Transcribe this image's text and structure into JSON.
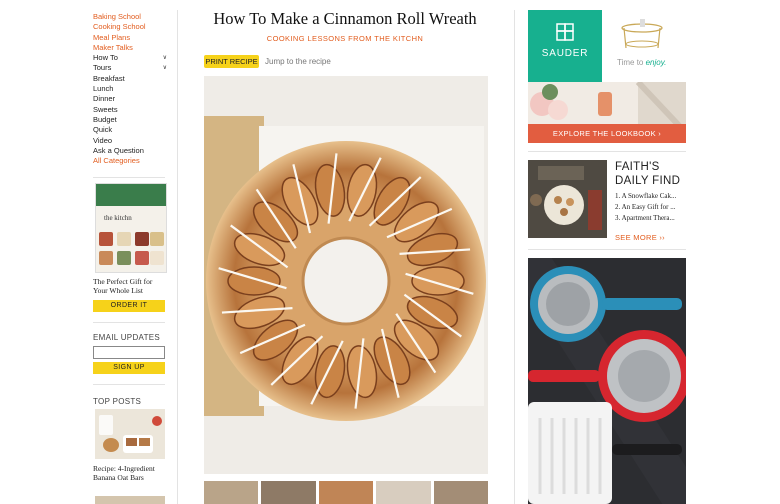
{
  "sidebar": {
    "nav": [
      {
        "label": "Baking School",
        "color": "orange",
        "chevron": false
      },
      {
        "label": "Cooking School",
        "color": "orange",
        "chevron": false
      },
      {
        "label": "Meal Plans",
        "color": "orange",
        "chevron": false
      },
      {
        "label": "Maker Talks",
        "color": "orange",
        "chevron": false
      },
      {
        "label": "How To",
        "color": "dark",
        "chevron": true
      },
      {
        "label": "Tours",
        "color": "dark",
        "chevron": true
      },
      {
        "label": "Breakfast",
        "color": "dark",
        "chevron": false
      },
      {
        "label": "Lunch",
        "color": "dark",
        "chevron": false
      },
      {
        "label": "Dinner",
        "color": "dark",
        "chevron": false
      },
      {
        "label": "Sweets",
        "color": "dark",
        "chevron": false
      },
      {
        "label": "Budget",
        "color": "dark",
        "chevron": false
      },
      {
        "label": "Quick",
        "color": "dark",
        "chevron": false
      },
      {
        "label": "Video",
        "color": "dark",
        "chevron": false
      },
      {
        "label": "Ask a Question",
        "color": "dark",
        "chevron": false
      },
      {
        "label": "All Categories",
        "color": "orange",
        "chevron": false
      }
    ],
    "promo": {
      "book_title": "the kitchn",
      "caption_line1": "The Perfect Gift for",
      "caption_line2": "Your Whole List",
      "button": "ORDER IT"
    },
    "email": {
      "heading": "EMAIL UPDATES",
      "placeholder": "",
      "button": "SIGN UP"
    },
    "top_posts": {
      "heading": "TOP POSTS",
      "caption_line1": "Recipe: 4-Ingredient",
      "caption_line2": "Banana Oat Bars"
    }
  },
  "article": {
    "title": "How To Make a Cinnamon Roll Wreath",
    "subtitle": "COOKING LESSONS FROM THE KITCHN",
    "print_button": "PRINT RECIPE",
    "jump_link": "Jump to the recipe"
  },
  "right": {
    "ad1": {
      "brand": "SAUDER",
      "tagline": "Time to",
      "tagline_em": "enjoy.",
      "cta": "EXPLORE THE LOOKBOOK ›"
    },
    "faiths_find": {
      "heading_line1": "FAITH'S",
      "heading_line2": "DAILY FIND",
      "items": [
        "1. A Snowflake Cak...",
        "2. An Easy Gift for ...",
        "3. Apartment Thera..."
      ],
      "see_more": "SEE MORE ››"
    }
  },
  "colors": {
    "accent": "#e25d1f",
    "button_yellow": "#f6d21a",
    "sauder_green": "#17b08f",
    "lookbook_red": "#e25d40"
  },
  "icons": {
    "nav_chevron": "chevron-down-icon",
    "sauder_logo": "sauder-logo-icon"
  }
}
